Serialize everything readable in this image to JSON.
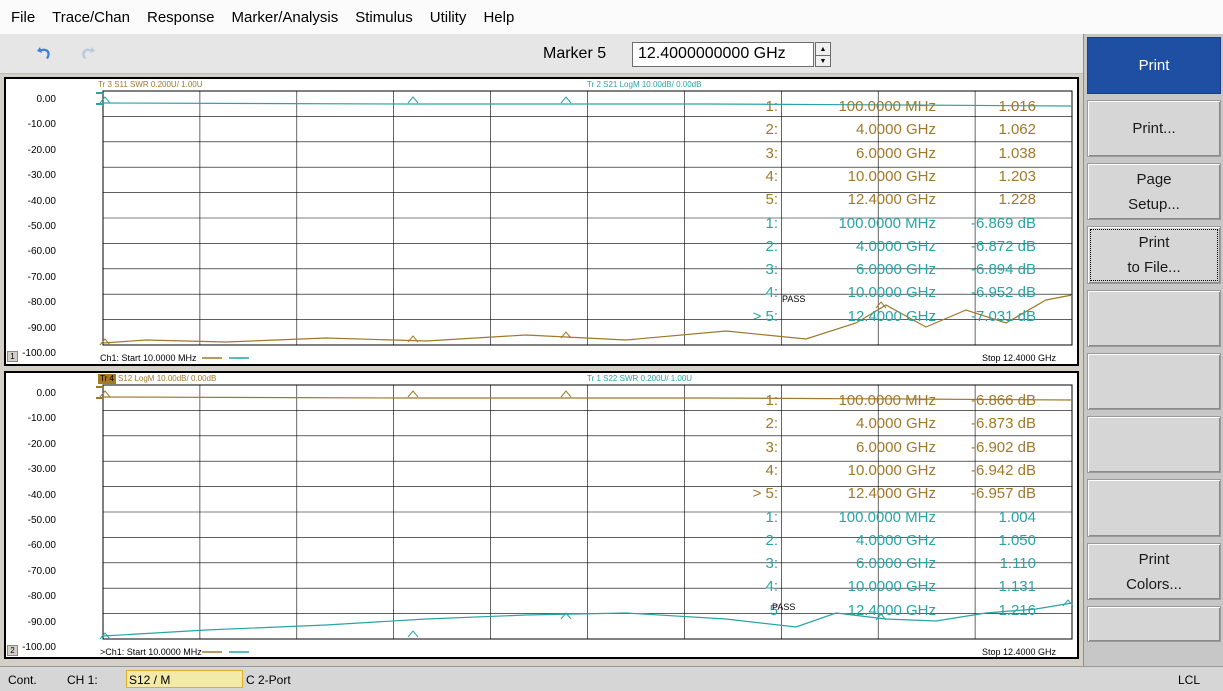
{
  "menubar": {
    "items": [
      "File",
      "Trace/Chan",
      "Response",
      "Marker/Analysis",
      "Stimulus",
      "Utility",
      "Help"
    ]
  },
  "toolbar": {
    "undo_icon": "undo-icon",
    "redo_icon": "redo-icon",
    "marker_label": "Marker 5",
    "marker_value": "12.4000000000 GHz"
  },
  "softkeys": [
    {
      "lines": [
        "Print",
        ""
      ],
      "active": true
    },
    {
      "lines": [
        "Print...",
        ""
      ],
      "active": false
    },
    {
      "lines": [
        "Page",
        "Setup..."
      ],
      "active": false
    },
    {
      "lines": [
        "Print",
        "to File..."
      ],
      "active": false,
      "focused": true
    },
    {
      "lines": [
        "",
        ""
      ],
      "active": false
    },
    {
      "lines": [
        "",
        ""
      ],
      "active": false
    },
    {
      "lines": [
        "",
        ""
      ],
      "active": false
    },
    {
      "lines": [
        "",
        ""
      ],
      "active": false
    },
    {
      "lines": [
        "Print",
        "Colors..."
      ],
      "active": false
    },
    {
      "lines": [
        "",
        ""
      ],
      "active": false
    }
  ],
  "channels": [
    {
      "num": "1",
      "y_ticks": [
        "0.00",
        "-10.00",
        "-20.00",
        "-30.00",
        "-40.00",
        "-50.00",
        "-60.00",
        "-70.00",
        "-80.00",
        "-90.00",
        "-100.00"
      ],
      "trace_left": "Tr 3  S11 SWR 0.200U/  1.00U",
      "trace_left_badge": false,
      "trace_right": "Tr 2  S21 LogM 10.00dB/  0.00dB",
      "markers": [
        {
          "idx": "1:",
          "freq": "100.0000 MHz",
          "val": "1.016",
          "color": "tan"
        },
        {
          "idx": "2:",
          "freq": "4.0000 GHz",
          "val": "1.062",
          "color": "tan"
        },
        {
          "idx": "3:",
          "freq": "6.0000 GHz",
          "val": "1.038",
          "color": "tan"
        },
        {
          "idx": "4:",
          "freq": "10.0000 GHz",
          "val": "1.203",
          "color": "tan"
        },
        {
          "idx": "5:",
          "freq": "12.4000 GHz",
          "val": "1.228",
          "color": "tan"
        },
        {
          "idx": "1:",
          "freq": "100.0000 MHz",
          "val": "-6.869 dB",
          "color": "teal"
        },
        {
          "idx": "2:",
          "freq": "4.0000 GHz",
          "val": "-6.872 dB",
          "color": "teal"
        },
        {
          "idx": "3:",
          "freq": "6.0000 GHz",
          "val": "-6.894 dB",
          "color": "teal"
        },
        {
          "idx": "4:",
          "freq": "10.0000 GHz",
          "val": "-6.952 dB",
          "color": "teal"
        },
        {
          "idx": "> 5:",
          "freq": "12.4000 GHz",
          "val": "-7.031 dB",
          "color": "teal"
        }
      ],
      "pass": "PASS",
      "footer_start": "Ch1:  Start  10.0000 MHz",
      "footer_stop": "Stop  12.4000 GHz"
    },
    {
      "num": "2",
      "y_ticks": [
        "0.00",
        "-10.00",
        "-20.00",
        "-30.00",
        "-40.00",
        "-50.00",
        "-60.00",
        "-70.00",
        "-80.00",
        "-90.00",
        "-100.00"
      ],
      "trace_left": "S12 LogM 10.00dB/  0.00dB",
      "trace_left_badge_text": "Tr 4",
      "trace_right": "Tr 1  S22 SWR 0.200U/  1.00U",
      "markers": [
        {
          "idx": "1:",
          "freq": "100.0000 MHz",
          "val": "-6.866 dB",
          "color": "tan"
        },
        {
          "idx": "2:",
          "freq": "4.0000 GHz",
          "val": "-6.873 dB",
          "color": "tan"
        },
        {
          "idx": "3:",
          "freq": "6.0000 GHz",
          "val": "-6.902 dB",
          "color": "tan"
        },
        {
          "idx": "4:",
          "freq": "10.0000 GHz",
          "val": "-6.942 dB",
          "color": "tan"
        },
        {
          "idx": "> 5:",
          "freq": "12.4000 GHz",
          "val": "-6.957 dB",
          "color": "tan"
        },
        {
          "idx": "1:",
          "freq": "100.0000 MHz",
          "val": "1.004",
          "color": "teal"
        },
        {
          "idx": "2:",
          "freq": "4.0000 GHz",
          "val": "1.050",
          "color": "teal"
        },
        {
          "idx": "3:",
          "freq": "6.0000 GHz",
          "val": "1.110",
          "color": "teal"
        },
        {
          "idx": "4:",
          "freq": "10.0000 GHz",
          "val": "1.131",
          "color": "teal"
        },
        {
          "idx": "5",
          "freq": "12.4000 GHz",
          "val": "1.216",
          "color": "teal"
        }
      ],
      "pass": "PASS",
      "footer_start": ">Ch1:  Start  10.0000 MHz",
      "footer_stop": "Stop  12.4000 GHz"
    }
  ],
  "statusbar": {
    "mode": "Cont.",
    "channel": "CH 1:",
    "measurement": "S12 / M",
    "calibration": "C  2-Port",
    "remote": "LCL"
  },
  "colors": {
    "tan": "#a0782b",
    "teal": "#2aa3a6",
    "softkey_active": "#1f4fa3"
  }
}
